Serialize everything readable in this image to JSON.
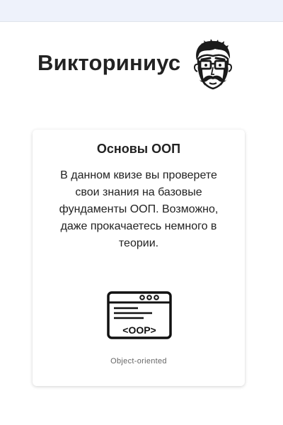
{
  "app": {
    "title": "Викториниус",
    "mascot_icon": "mustache-nerd-face-icon"
  },
  "quiz_card": {
    "title": "Основы ООП",
    "description": "В данном квизе вы проверете свои знания на базовые фундаменты ООП. Возможно, даже прокачаетесь немного в теории.",
    "image_icon": "oop-browser-window-icon",
    "image_text": "<OOP>",
    "caption": "Object-oriented"
  },
  "colors": {
    "topbar": "#eef2fb",
    "text": "#222222",
    "caption": "#666666"
  }
}
